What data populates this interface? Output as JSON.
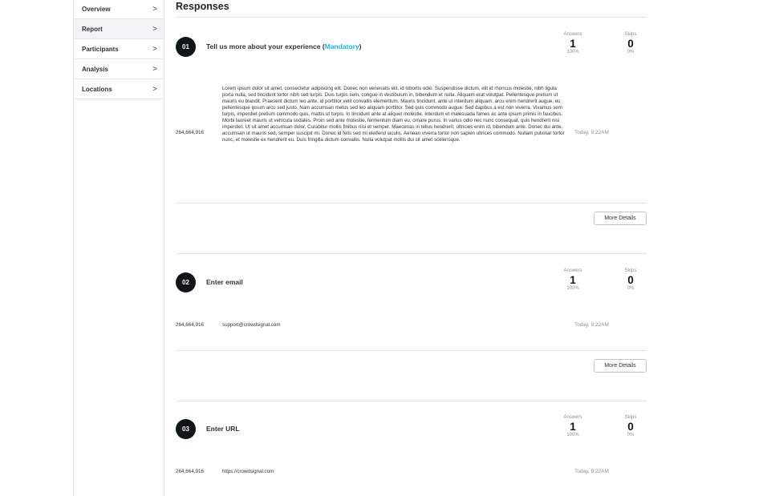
{
  "sidebar": {
    "items": [
      {
        "label": "Overview",
        "chevron": ">"
      },
      {
        "label": "Report",
        "chevron": ">"
      },
      {
        "label": "Participants",
        "chevron": ">"
      },
      {
        "label": "Analysis",
        "chevron": ">"
      },
      {
        "label": "Locations",
        "chevron": ">"
      }
    ],
    "active_item": "Report"
  },
  "main": {
    "title": "Responses",
    "stat_labels": {
      "answers": "Answers",
      "skips": "Skips"
    },
    "more_details_label": "More Details",
    "questions": [
      {
        "number": "01",
        "text": "Tell us more about your experience (",
        "mandatory_label": "Mandatory",
        "text_suffix": ")",
        "answers": "1",
        "answers_pct": "100%",
        "skips": "0",
        "skips_pct": "0%",
        "response": {
          "id": "264,664,916",
          "value": "Lorem ipsum dolor sit amet, consectetur adipiscing elit. Donec non venenatis elit, id lobortis odio. Suspendisse dictum, elit id rhoncus molestie, nibh ligula porta nulla, sed tincidunt tortor nibh sed turpis. Duis turpis sem, congue in vestibulum in, bibendum et nulla. Aliquam erat volutpat.  Pellentesque pretium ut mauris eu blandit. Praesent dictum leo ante, id porttitor velit convallis elementum. Mauris tincidunt, ante ut interdum aliquam, arcu enim hendrerit augue, eu pellentesque ipsum arcu sed justo. Nam accumsan metus sed leo aliquam porttitor. Sed quis commodo augue. Sed dapibus a est non viverra. Vivamus sem turpis, imperdiet pretium commodo quis, mattis ut turpis. In tincidunt ante at aliquet molestie. Interdum et malesuada fames ac ante ipsum primis in faucibus. Morbi laoreet mauris ut vehicula sodales. Proin sed ante molestie, fermentum diam eu, ornare purus. In varius odio nec nunc consequat, quis hendrerit nisi imperdiet. Ut sit amet accumsan dolor. Curabitur mollis finibus nisi et semper. Maecenas in tellus hendrerit, ultricies enim id, bibendum ante. Donec dui ante, accumsan ut mauris sed, semper suscipit mi. Donec id felis sed mi eleifend iaculis. Aenean viverra tortor non sapien ultrices commodo. Nullam pulvinar tortor nunc, et molestie ex hendrerit eu. Duis fringilla dictum convallis. Nulla volutpat mollis dui sit amet scelerisque.",
          "time": "Today, 9:22AM"
        }
      },
      {
        "number": "02",
        "text": "Enter email",
        "answers": "1",
        "answers_pct": "100%",
        "skips": "0",
        "skips_pct": "0%",
        "response": {
          "id": "264,664,916",
          "value": "support@crowdsignal.com",
          "time": "Today, 9:22AM"
        }
      },
      {
        "number": "03",
        "text": "Enter URL",
        "answers": "1",
        "answers_pct": "100%",
        "skips": "0",
        "skips_pct": "0%",
        "response": {
          "id": "264,664,916",
          "value": "https://crowdsignal.com",
          "time": "Today, 9:22AM"
        }
      }
    ]
  }
}
